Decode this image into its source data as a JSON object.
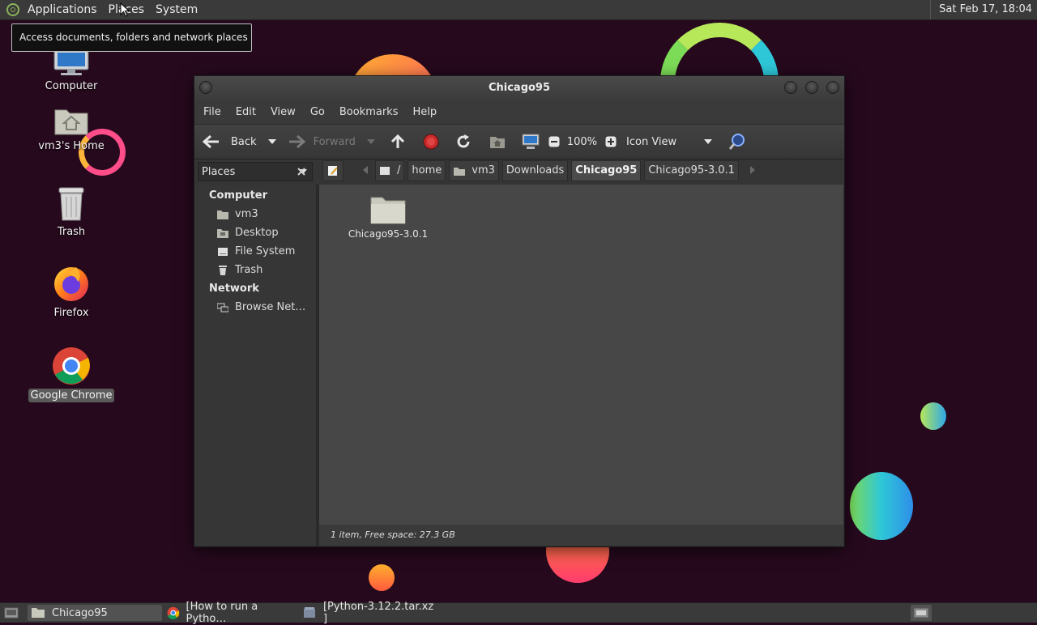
{
  "top_panel": {
    "menus": [
      "Applications",
      "Places",
      "System"
    ],
    "clock": "Sat Feb 17, 18:04"
  },
  "tooltip": "Access documents, folders and network places",
  "desktop_icons": [
    {
      "label": "Computer",
      "icon": "computer-icon"
    },
    {
      "label": "vm3's Home",
      "icon": "home-folder-icon"
    },
    {
      "label": "Trash",
      "icon": "trash-icon"
    },
    {
      "label": "Firefox",
      "icon": "firefox-icon"
    },
    {
      "label": "Google Chrome",
      "icon": "chrome-icon",
      "selected": true
    }
  ],
  "window": {
    "title": "Chicago95",
    "menu": [
      "File",
      "Edit",
      "View",
      "Go",
      "Bookmarks",
      "Help"
    ],
    "toolbar": {
      "back": "Back",
      "forward": "Forward",
      "zoom": "100%",
      "view_mode": "Icon View"
    },
    "sidebar": {
      "combo_label": "Places",
      "sections": [
        {
          "header": "Computer",
          "items": [
            "vm3",
            "Desktop",
            "File System",
            "Trash"
          ]
        },
        {
          "header": "Network",
          "items": [
            "Browse Net…"
          ]
        }
      ]
    },
    "breadcrumbs": [
      "/",
      "home",
      "vm3",
      "Downloads",
      "Chicago95",
      "Chicago95-3.0.1"
    ],
    "active_crumb": "Chicago95",
    "files": [
      {
        "name": "Chicago95-3.0.1",
        "type": "folder"
      }
    ],
    "status": "1 item, Free space: 27.3 GB"
  },
  "taskbar": {
    "tasks": [
      "Chicago95",
      "[How to run a Pytho…",
      "[Python-3.12.2.tar.xz ]"
    ]
  },
  "colors": {
    "desktop_bg": "#26091d",
    "panel_bg": "#3a3a3a",
    "window_content_bg": "#474747"
  }
}
